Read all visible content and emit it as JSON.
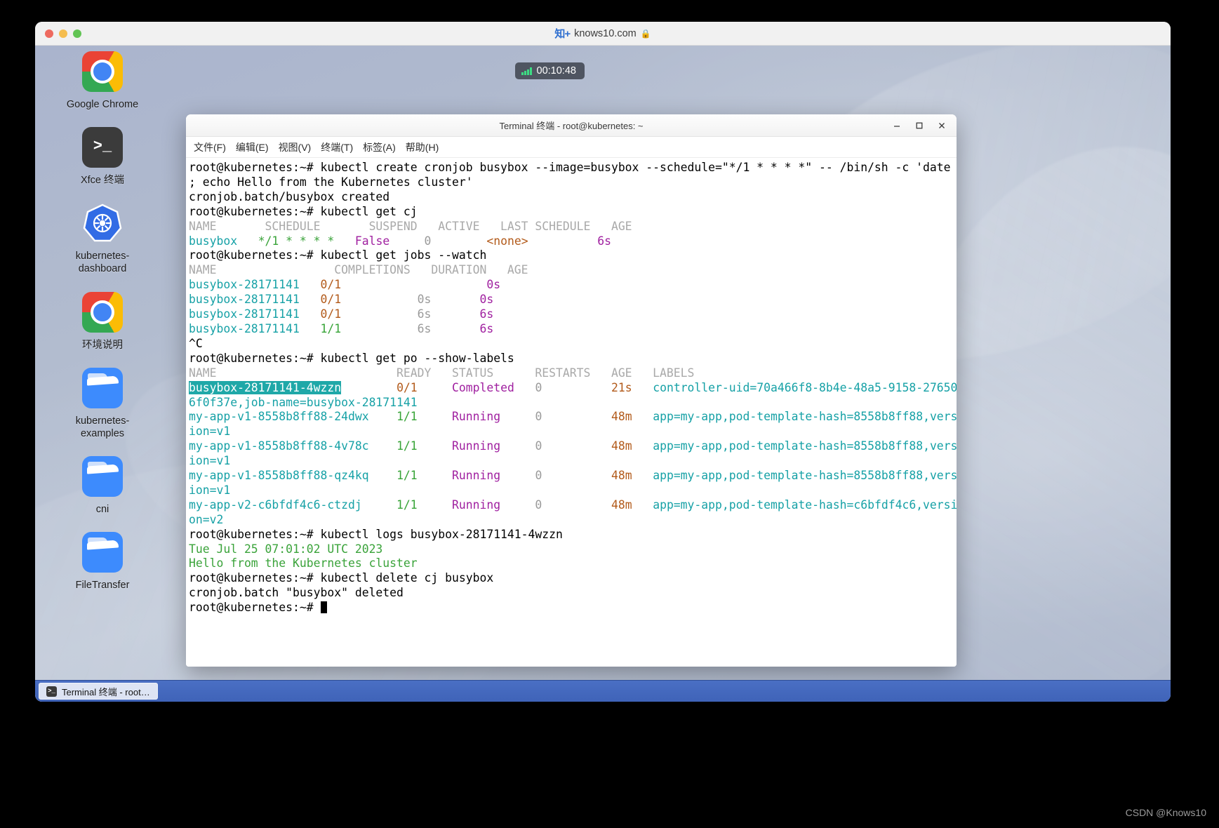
{
  "browser": {
    "url": "knows10.com",
    "zhi_badge": "知+",
    "lock_icon": "lock-icon",
    "traffic_lights": [
      "close",
      "minimize",
      "maximize"
    ]
  },
  "timer": {
    "value": "00:10:48",
    "signal_icon": "signal-bars-icon"
  },
  "desktop": {
    "icons": [
      {
        "label": "Google Chrome",
        "icon": "chrome-icon",
        "type": "chrome"
      },
      {
        "label": "Xfce 终端",
        "icon": "terminal-icon",
        "type": "terminal",
        "glyph": ">_"
      },
      {
        "label": "kubernetes-dashboard",
        "icon": "kubernetes-icon",
        "type": "k8s"
      },
      {
        "label": "环境说明",
        "icon": "chrome-icon",
        "type": "chrome"
      },
      {
        "label": "kubernetes-examples",
        "icon": "folder-icon",
        "type": "folder"
      },
      {
        "label": "cni",
        "icon": "folder-icon",
        "type": "folder"
      },
      {
        "label": "FileTransfer",
        "icon": "folder-icon",
        "type": "folder"
      }
    ]
  },
  "terminal": {
    "title": "Terminal 终端 - root@kubernetes: ~",
    "window_buttons": [
      {
        "name": "minimize-button",
        "glyph": "–"
      },
      {
        "name": "maximize-button",
        "glyph": "□"
      },
      {
        "name": "close-button",
        "glyph": "✕"
      }
    ],
    "menu": [
      "文件(F)",
      "编辑(E)",
      "视图(V)",
      "终端(T)",
      "标签(A)",
      "帮助(H)"
    ],
    "prompt": "root@kubernetes:~#",
    "lines": [
      {
        "segs": [
          {
            "t": "root@kubernetes:~# kubectl create cronjob busybox --image=busybox --schedule=\"*/1 * * * *\" -- /bin/sh -c 'date",
            "c": "default"
          }
        ]
      },
      {
        "segs": [
          {
            "t": "; echo Hello from the Kubernetes cluster'",
            "c": "default"
          }
        ]
      },
      {
        "segs": [
          {
            "t": "cronjob.batch/busybox created",
            "c": "default"
          }
        ]
      },
      {
        "segs": [
          {
            "t": "root@kubernetes:~# kubectl get cj",
            "c": "default"
          }
        ]
      },
      {
        "segs": [
          {
            "t": "NAME       SCHEDULE       SUSPEND   ACTIVE   LAST SCHEDULE   AGE",
            "c": "gray"
          }
        ]
      },
      {
        "segs": [
          {
            "t": "busybox",
            "c": "teal"
          },
          {
            "t": "   ",
            "c": "default"
          },
          {
            "t": "*/1 * * * *",
            "c": "green"
          },
          {
            "t": "   ",
            "c": "default"
          },
          {
            "t": "False",
            "c": "magenta"
          },
          {
            "t": "     ",
            "c": "default"
          },
          {
            "t": "0",
            "c": "dgray"
          },
          {
            "t": "        ",
            "c": "default"
          },
          {
            "t": "<none>",
            "c": "orange"
          },
          {
            "t": "          ",
            "c": "default"
          },
          {
            "t": "6s",
            "c": "magenta"
          }
        ]
      },
      {
        "segs": [
          {
            "t": "root@kubernetes:~# kubectl get jobs --watch",
            "c": "default"
          }
        ]
      },
      {
        "segs": [
          {
            "t": "NAME                 COMPLETIONS   DURATION   AGE",
            "c": "gray"
          }
        ]
      },
      {
        "segs": [
          {
            "t": "busybox-28171141",
            "c": "teal"
          },
          {
            "t": "   ",
            "c": "default"
          },
          {
            "t": "0/1",
            "c": "orange"
          },
          {
            "t": "                     ",
            "c": "default"
          },
          {
            "t": "0s",
            "c": "magenta"
          }
        ]
      },
      {
        "segs": [
          {
            "t": "busybox-28171141",
            "c": "teal"
          },
          {
            "t": "   ",
            "c": "default"
          },
          {
            "t": "0/1",
            "c": "orange"
          },
          {
            "t": "           ",
            "c": "default"
          },
          {
            "t": "0s",
            "c": "dgray"
          },
          {
            "t": "       ",
            "c": "default"
          },
          {
            "t": "0s",
            "c": "magenta"
          }
        ]
      },
      {
        "segs": [
          {
            "t": "busybox-28171141",
            "c": "teal"
          },
          {
            "t": "   ",
            "c": "default"
          },
          {
            "t": "0/1",
            "c": "orange"
          },
          {
            "t": "           ",
            "c": "default"
          },
          {
            "t": "6s",
            "c": "dgray"
          },
          {
            "t": "       ",
            "c": "default"
          },
          {
            "t": "6s",
            "c": "magenta"
          }
        ]
      },
      {
        "segs": [
          {
            "t": "busybox-28171141",
            "c": "teal"
          },
          {
            "t": "   ",
            "c": "default"
          },
          {
            "t": "1/1",
            "c": "lgreen"
          },
          {
            "t": "           ",
            "c": "default"
          },
          {
            "t": "6s",
            "c": "dgray"
          },
          {
            "t": "       ",
            "c": "default"
          },
          {
            "t": "6s",
            "c": "magenta"
          }
        ]
      },
      {
        "segs": [
          {
            "t": "^C",
            "c": "default"
          }
        ]
      },
      {
        "segs": [
          {
            "t": "root@kubernetes:~# kubectl get po --show-labels",
            "c": "default"
          }
        ]
      },
      {
        "segs": [
          {
            "t": "NAME                          READY   STATUS      RESTARTS   AGE   LABELS",
            "c": "gray"
          }
        ]
      },
      {
        "segs": [
          {
            "t": "busybox-28171141-4wzzn",
            "c": "sel"
          },
          {
            "t": "        ",
            "c": "default"
          },
          {
            "t": "0/1",
            "c": "orange"
          },
          {
            "t": "     ",
            "c": "default"
          },
          {
            "t": "Completed",
            "c": "magenta"
          },
          {
            "t": "   ",
            "c": "default"
          },
          {
            "t": "0",
            "c": "dgray"
          },
          {
            "t": "          ",
            "c": "default"
          },
          {
            "t": "21s",
            "c": "orange"
          },
          {
            "t": "   ",
            "c": "default"
          },
          {
            "t": "controller-uid=70a466f8-8b4e-48a5-9158-27650",
            "c": "teal"
          }
        ]
      },
      {
        "segs": [
          {
            "t": "6f0f37e,job-name=busybox-28171141",
            "c": "teal"
          }
        ]
      },
      {
        "segs": [
          {
            "t": "my-app-v1-8558b8ff88-24dwx",
            "c": "teal"
          },
          {
            "t": "    ",
            "c": "default"
          },
          {
            "t": "1/1",
            "c": "lgreen"
          },
          {
            "t": "     ",
            "c": "default"
          },
          {
            "t": "Running",
            "c": "magenta"
          },
          {
            "t": "     ",
            "c": "default"
          },
          {
            "t": "0",
            "c": "dgray"
          },
          {
            "t": "          ",
            "c": "default"
          },
          {
            "t": "48m",
            "c": "orange"
          },
          {
            "t": "   ",
            "c": "default"
          },
          {
            "t": "app=my-app,pod-template-hash=8558b8ff88,vers",
            "c": "teal"
          }
        ]
      },
      {
        "segs": [
          {
            "t": "ion=v1",
            "c": "teal"
          }
        ]
      },
      {
        "segs": [
          {
            "t": "my-app-v1-8558b8ff88-4v78c",
            "c": "teal"
          },
          {
            "t": "    ",
            "c": "default"
          },
          {
            "t": "1/1",
            "c": "lgreen"
          },
          {
            "t": "     ",
            "c": "default"
          },
          {
            "t": "Running",
            "c": "magenta"
          },
          {
            "t": "     ",
            "c": "default"
          },
          {
            "t": "0",
            "c": "dgray"
          },
          {
            "t": "          ",
            "c": "default"
          },
          {
            "t": "48m",
            "c": "orange"
          },
          {
            "t": "   ",
            "c": "default"
          },
          {
            "t": "app=my-app,pod-template-hash=8558b8ff88,vers",
            "c": "teal"
          }
        ]
      },
      {
        "segs": [
          {
            "t": "ion=v1",
            "c": "teal"
          }
        ]
      },
      {
        "segs": [
          {
            "t": "my-app-v1-8558b8ff88-qz4kq",
            "c": "teal"
          },
          {
            "t": "    ",
            "c": "default"
          },
          {
            "t": "1/1",
            "c": "lgreen"
          },
          {
            "t": "     ",
            "c": "default"
          },
          {
            "t": "Running",
            "c": "magenta"
          },
          {
            "t": "     ",
            "c": "default"
          },
          {
            "t": "0",
            "c": "dgray"
          },
          {
            "t": "          ",
            "c": "default"
          },
          {
            "t": "48m",
            "c": "orange"
          },
          {
            "t": "   ",
            "c": "default"
          },
          {
            "t": "app=my-app,pod-template-hash=8558b8ff88,vers",
            "c": "teal"
          }
        ]
      },
      {
        "segs": [
          {
            "t": "ion=v1",
            "c": "teal"
          }
        ]
      },
      {
        "segs": [
          {
            "t": "my-app-v2-c6bfdf4c6-ctzdj",
            "c": "teal"
          },
          {
            "t": "     ",
            "c": "default"
          },
          {
            "t": "1/1",
            "c": "lgreen"
          },
          {
            "t": "     ",
            "c": "default"
          },
          {
            "t": "Running",
            "c": "magenta"
          },
          {
            "t": "     ",
            "c": "default"
          },
          {
            "t": "0",
            "c": "dgray"
          },
          {
            "t": "          ",
            "c": "default"
          },
          {
            "t": "48m",
            "c": "orange"
          },
          {
            "t": "   ",
            "c": "default"
          },
          {
            "t": "app=my-app,pod-template-hash=c6bfdf4c6,versi",
            "c": "teal"
          }
        ]
      },
      {
        "segs": [
          {
            "t": "on=v2",
            "c": "teal"
          }
        ]
      },
      {
        "segs": [
          {
            "t": "root@kubernetes:~# kubectl logs busybox-28171141-4wzzn",
            "c": "default"
          }
        ]
      },
      {
        "segs": [
          {
            "t": "Tue Jul 25 07:01:02 UTC 2023",
            "c": "green"
          }
        ]
      },
      {
        "segs": [
          {
            "t": "Hello from the Kubernetes cluster",
            "c": "green"
          }
        ]
      },
      {
        "segs": [
          {
            "t": "root@kubernetes:~# kubectl delete cj busybox",
            "c": "default"
          }
        ]
      },
      {
        "segs": [
          {
            "t": "cronjob.batch \"busybox\" deleted",
            "c": "default"
          }
        ]
      },
      {
        "segs": [
          {
            "t": "root@kubernetes:~# ",
            "c": "default"
          },
          {
            "t": "",
            "c": "cursor"
          }
        ]
      }
    ]
  },
  "taskbar": {
    "items": [
      {
        "label": "Terminal 终端 - root…",
        "icon": "terminal-icon",
        "glyph": ">_"
      }
    ]
  },
  "watermark": "CSDN @Knows10",
  "colors": {
    "accent_teal": "#16a1a6",
    "selection": "#1fa8a8",
    "taskbar": "#4a6fc4",
    "timer_bg": "#4f5561",
    "signal_green": "#3ddc84"
  }
}
